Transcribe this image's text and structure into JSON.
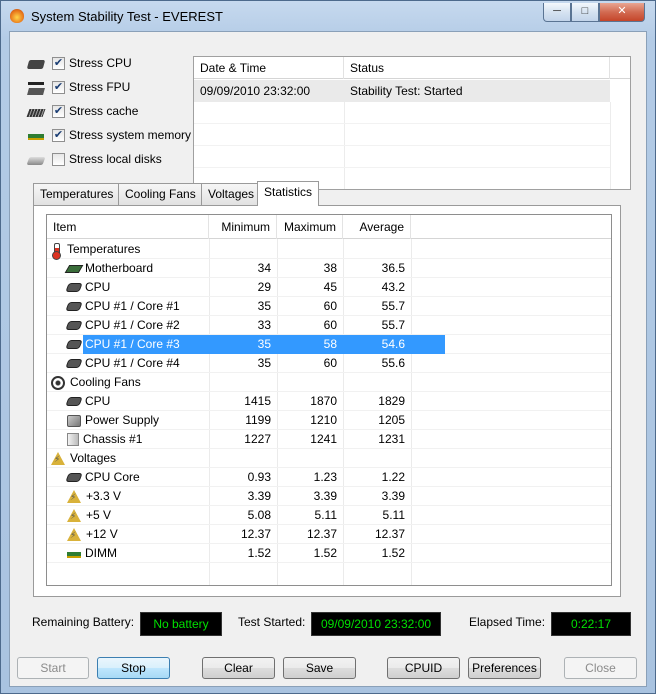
{
  "window": {
    "title": "System Stability Test - EVEREST",
    "min": "─",
    "max": "□",
    "close": "✕"
  },
  "stress_options": [
    {
      "label": "Stress CPU",
      "checked": true,
      "icon": "cpu-icon"
    },
    {
      "label": "Stress FPU",
      "checked": true,
      "icon": "fpu-icon"
    },
    {
      "label": "Stress cache",
      "checked": true,
      "icon": "cache-icon"
    },
    {
      "label": "Stress system memory",
      "checked": true,
      "icon": "memory-icon"
    },
    {
      "label": "Stress local disks",
      "checked": false,
      "icon": "disk-icon"
    }
  ],
  "check_glyph": "✔",
  "log": {
    "columns": [
      "Date & Time",
      "Status"
    ],
    "rows": [
      {
        "datetime": "09/09/2010 23:32:00",
        "status": "Stability Test: Started"
      }
    ]
  },
  "tabs": [
    "Temperatures",
    "Cooling Fans",
    "Voltages",
    "Statistics"
  ],
  "active_tab": "Statistics",
  "stats": {
    "columns": [
      "Item",
      "Minimum",
      "Maximum",
      "Average"
    ],
    "rows": [
      {
        "type": "group",
        "name": "Temperatures",
        "icon": "thermometer-icon"
      },
      {
        "type": "item",
        "name": "Motherboard",
        "min": "34",
        "max": "38",
        "avg": "36.5",
        "icon": "motherboard-icon"
      },
      {
        "type": "item",
        "name": "CPU",
        "min": "29",
        "max": "45",
        "avg": "43.2",
        "icon": "cpu-chip-icon"
      },
      {
        "type": "item",
        "name": "CPU #1 / Core #1",
        "min": "35",
        "max": "60",
        "avg": "55.7",
        "icon": "cpu-chip-icon"
      },
      {
        "type": "item",
        "name": "CPU #1 / Core #2",
        "min": "33",
        "max": "60",
        "avg": "55.7",
        "icon": "cpu-chip-icon"
      },
      {
        "type": "item",
        "name": "CPU #1 / Core #3",
        "min": "35",
        "max": "58",
        "avg": "54.6",
        "icon": "cpu-chip-icon",
        "selected": true
      },
      {
        "type": "item",
        "name": "CPU #1 / Core #4",
        "min": "35",
        "max": "60",
        "avg": "55.6",
        "icon": "cpu-chip-icon"
      },
      {
        "type": "group",
        "name": "Cooling Fans",
        "icon": "fan-icon"
      },
      {
        "type": "item",
        "name": "CPU",
        "min": "1415",
        "max": "1870",
        "avg": "1829",
        "icon": "cpu-chip-icon"
      },
      {
        "type": "item",
        "name": "Power Supply",
        "min": "1199",
        "max": "1210",
        "avg": "1205",
        "icon": "power-supply-icon"
      },
      {
        "type": "item",
        "name": "Chassis #1",
        "min": "1227",
        "max": "1241",
        "avg": "1231",
        "icon": "chassis-icon"
      },
      {
        "type": "group",
        "name": "Voltages",
        "icon": "voltage-icon"
      },
      {
        "type": "item",
        "name": "CPU Core",
        "min": "0.93",
        "max": "1.23",
        "avg": "1.22",
        "icon": "cpu-chip-icon"
      },
      {
        "type": "item",
        "name": "+3.3 V",
        "min": "3.39",
        "max": "3.39",
        "avg": "3.39",
        "icon": "voltage-icon"
      },
      {
        "type": "item",
        "name": "+5 V",
        "min": "5.08",
        "max": "5.11",
        "avg": "5.11",
        "icon": "voltage-icon"
      },
      {
        "type": "item",
        "name": "+12 V",
        "min": "12.37",
        "max": "12.37",
        "avg": "12.37",
        "icon": "voltage-icon"
      },
      {
        "type": "item",
        "name": "DIMM",
        "min": "1.52",
        "max": "1.52",
        "avg": "1.52",
        "icon": "dimm-icon"
      }
    ]
  },
  "status": {
    "battery_label": "Remaining Battery:",
    "battery_value": "No battery",
    "started_label": "Test Started:",
    "started_value": "09/09/2010 23:32:00",
    "elapsed_label": "Elapsed Time:",
    "elapsed_value": "0:22:17"
  },
  "buttons": {
    "start": "Start",
    "stop": "Stop",
    "clear": "Clear",
    "save": "Save",
    "cpuid": "CPUID",
    "preferences": "Preferences",
    "close": "Close"
  },
  "colors": {
    "lcd_text": "#00e000",
    "selection": "#3399ff"
  }
}
